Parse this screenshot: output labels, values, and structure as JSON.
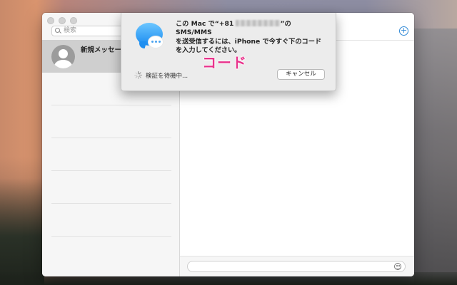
{
  "colors": {
    "accent": "#2f88d6",
    "code_label": "#e8348c",
    "selected_row": "#cfcfcf"
  },
  "sidebar": {
    "search_placeholder": "検索",
    "conversation": {
      "name": "新規メッセージ",
      "avatar": "person-silhouette-icon"
    }
  },
  "main": {
    "compose_icon": "plus-circle-icon",
    "emoji_icon": "smiley-icon"
  },
  "sheet": {
    "app_icon": "messages-bubble-icon",
    "text_line1_prefix": "この Mac で“+81",
    "text_line1_suffix": "”の SMS/MMS",
    "text_line2": "を送受信するには、iPhone で今すぐ下のコード",
    "text_line3": "を入力してください。",
    "code_annotation": "コード",
    "status": "検証を待機中...",
    "cancel_label": "キャンセル"
  }
}
